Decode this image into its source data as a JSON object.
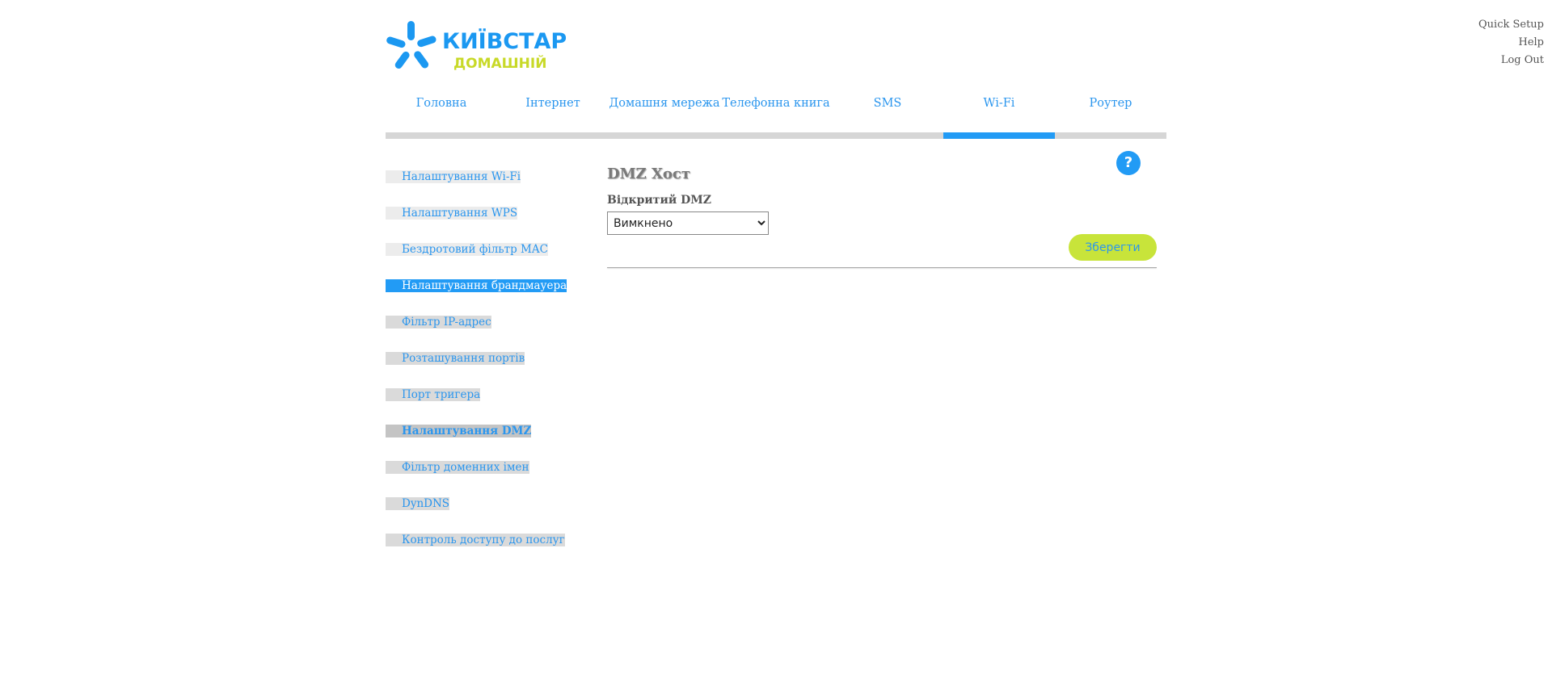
{
  "top_links": [
    "Quick Setup",
    "Help",
    "Log Out"
  ],
  "logo": {
    "brand": "КИЇВСТАР",
    "sub": "ДОМАШНІЙ"
  },
  "colors": {
    "accent": "#229bf5",
    "save": "#c8e43a"
  },
  "main_nav": {
    "tabs": [
      "Головна",
      "Інтернет",
      "Домашня мережа",
      "Телефонна книга",
      "SMS",
      "Wi-Fi",
      "Роутер"
    ],
    "active": "Wi-Fi"
  },
  "sidebar": {
    "items": [
      "Налаштування Wi-Fi",
      "Налаштування WPS",
      "Бездротовий фільтр MAC",
      "Налаштування брандмауера",
      "Фільтр IP-адрес",
      "Розташування портів",
      "Порт тригера",
      "Налаштування DMZ",
      "Фільтр доменних імен",
      "DynDNS",
      "Контроль доступу до послуг"
    ]
  },
  "help": {
    "label": "?"
  },
  "content": {
    "title": "DMZ Хост",
    "field_label": "Відкритий DMZ",
    "select_value": "Вимкнено",
    "save_label": "Зберегти"
  }
}
